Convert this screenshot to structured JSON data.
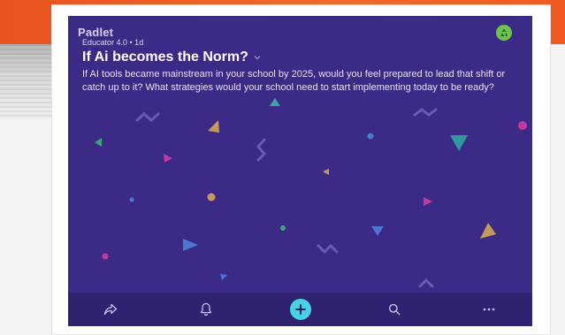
{
  "padlet": {
    "brand": "Padlet",
    "meta": "Educator 4.0 • 1d",
    "title": "If Ai becomes the Norm?",
    "description": "If AI tools became mainstream in your school by 2025, would you feel prepared to lead that shift or catch up to it?  What strategies would your school need to start implementing today to be ready?",
    "background_color": "#3b2a86",
    "bottom_bar_color": "#2f2270",
    "accent_color": "#48d1e6",
    "avatar_icon": "recycle-icon"
  },
  "toolbar": {
    "items": [
      {
        "icon": "share-icon"
      },
      {
        "icon": "bell-icon"
      },
      {
        "icon": "plus-icon"
      },
      {
        "icon": "search-icon"
      },
      {
        "icon": "more-icon"
      }
    ]
  }
}
